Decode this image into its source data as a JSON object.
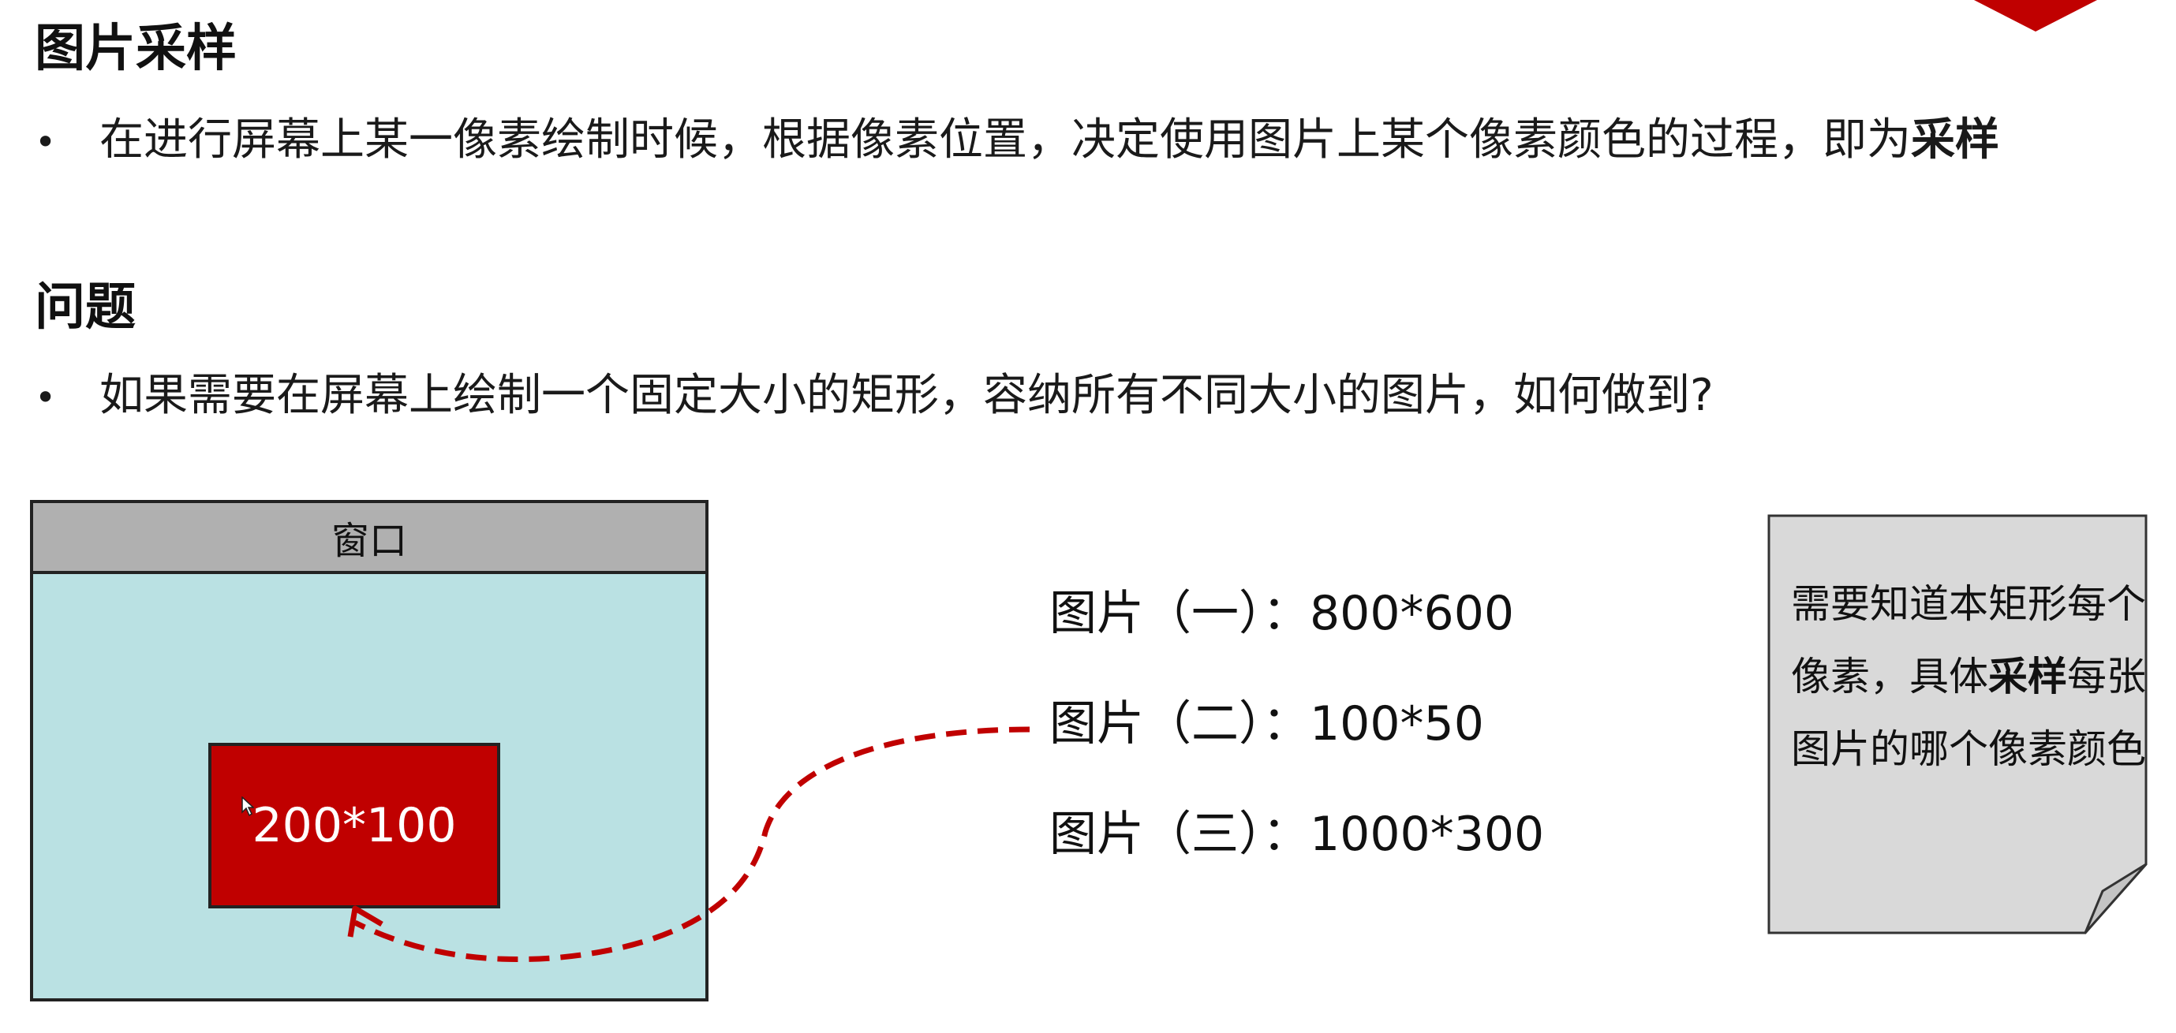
{
  "section1": {
    "heading": "图片采样",
    "bullet": "在进行屏幕上某一像素绘制时候，根据像素位置，决定使用图片上某个像素颜色的过程，即为",
    "bullet_bold": "采样"
  },
  "section2": {
    "heading": "问题",
    "bullet": "如果需要在屏幕上绘制一个固定大小的矩形，容纳所有不同大小的图片，如何做到?"
  },
  "diagram": {
    "window_title": "窗口",
    "rect_label": "200*100",
    "images": [
      {
        "label": "图片（一）：800*600"
      },
      {
        "label": "图片（二）：100*50"
      },
      {
        "label": "图片（三）：1000*300"
      }
    ]
  },
  "note": {
    "part1": "需要知道本矩形每个像素，具体",
    "bold": "采样",
    "part2": "每张图片的哪个像素颜色"
  },
  "colors": {
    "accent_red": "#c00000",
    "window_bg": "#bae1e3",
    "titlebar_bg": "#b0b0b0",
    "note_bg": "#d9d9d9"
  }
}
